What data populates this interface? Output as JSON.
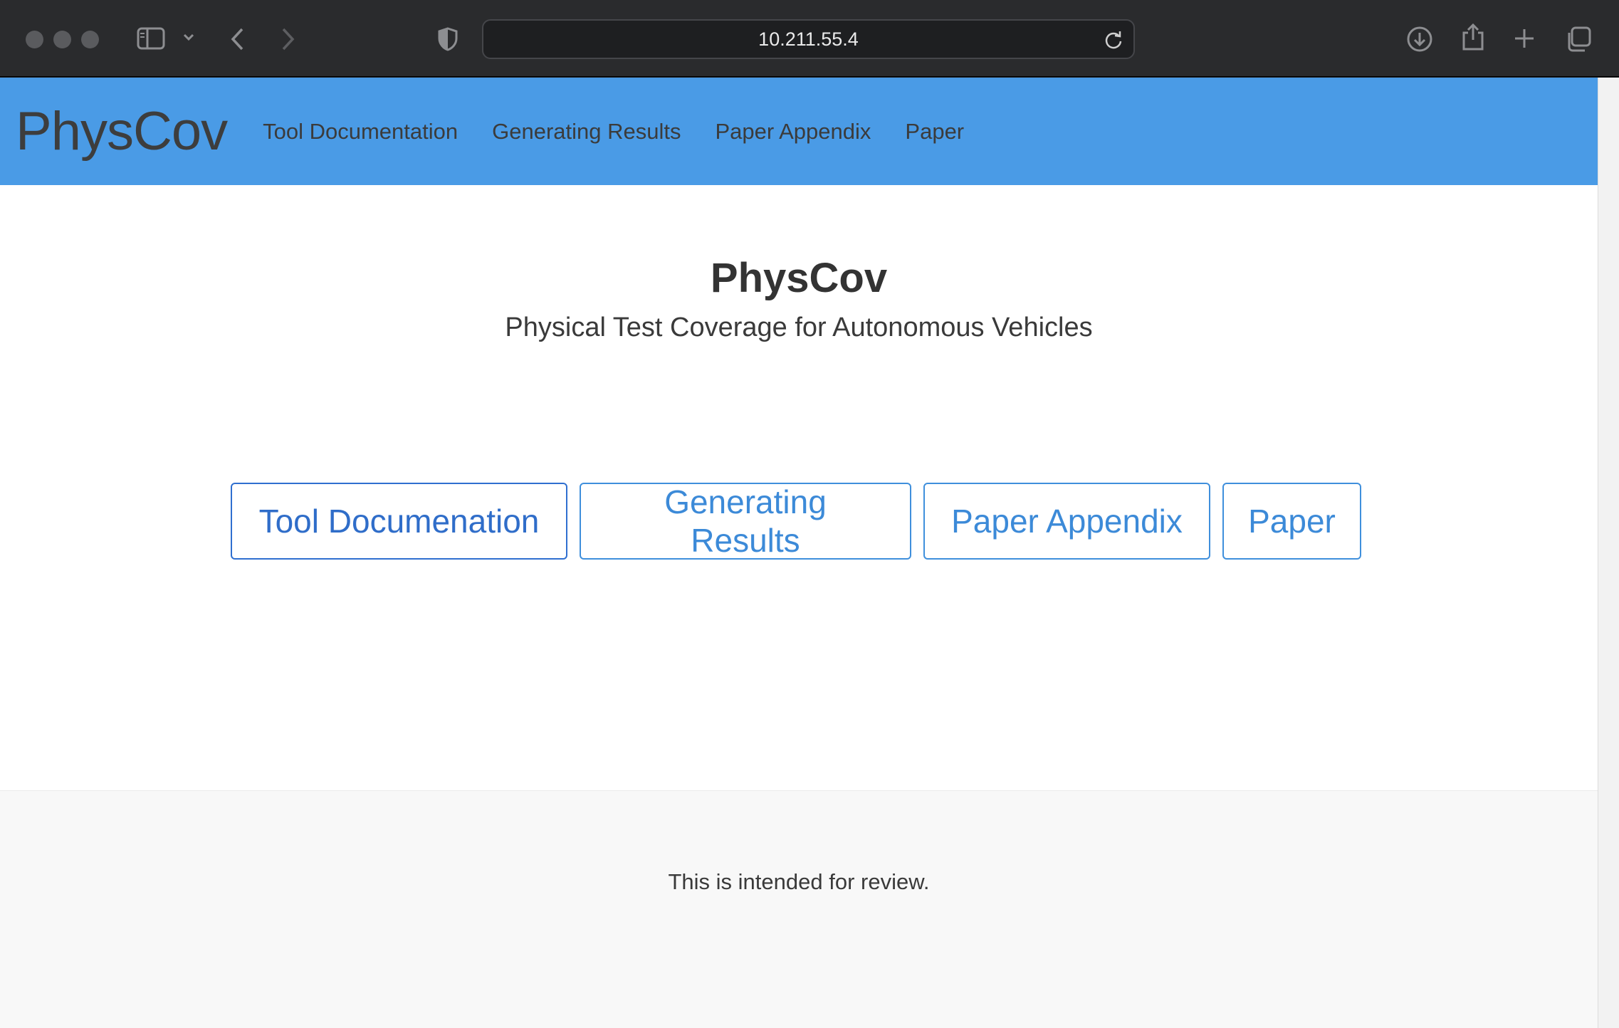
{
  "browser": {
    "url": "10.211.55.4",
    "icons": [
      "sidebar-icon",
      "chevron-down-icon",
      "back-icon",
      "forward-icon",
      "shield-icon",
      "reload-icon",
      "download-icon",
      "share-icon",
      "new-tab-icon",
      "tab-overview-icon"
    ]
  },
  "navbar": {
    "brand": "PhysCov",
    "links": [
      "Tool Documentation",
      "Generating Results",
      "Paper Appendix",
      "Paper"
    ],
    "background": "#4a9be6"
  },
  "hero": {
    "title": "PhysCov",
    "subtitle": "Physical Test Coverage for Autonomous Vehicles"
  },
  "buttons": [
    "Tool Documenation",
    "Generating Results",
    "Paper Appendix",
    "Paper"
  ],
  "footer": {
    "text": "This is intended for review."
  },
  "colors": {
    "accent": "#3c8ad8",
    "chrome": "#2a2b2d"
  }
}
